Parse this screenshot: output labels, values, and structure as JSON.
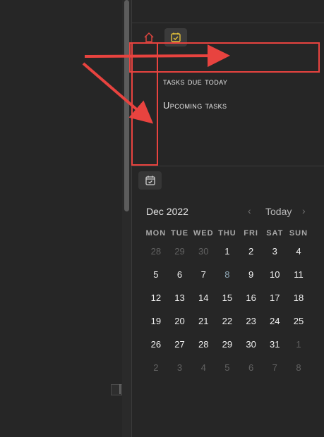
{
  "tabs": {
    "home_icon": "home-icon",
    "tasks_icon": "checkbox-calendar-icon"
  },
  "tasks": {
    "due_today": "tasks due today",
    "upcoming": "Upcoming tasks"
  },
  "calendar": {
    "tab_icon": "calendar-check-icon",
    "month_label": "Dec 2022",
    "prev": "‹",
    "today_label": "Today",
    "next": "›",
    "weekdays": [
      "MON",
      "TUE",
      "WED",
      "THU",
      "FRI",
      "SAT",
      "SUN"
    ],
    "weeks": [
      [
        {
          "d": "28",
          "o": true
        },
        {
          "d": "29",
          "o": true
        },
        {
          "d": "30",
          "o": true
        },
        {
          "d": "1"
        },
        {
          "d": "2"
        },
        {
          "d": "3"
        },
        {
          "d": "4"
        }
      ],
      [
        {
          "d": "5"
        },
        {
          "d": "6"
        },
        {
          "d": "7"
        },
        {
          "d": "8",
          "t": true
        },
        {
          "d": "9"
        },
        {
          "d": "10"
        },
        {
          "d": "11"
        }
      ],
      [
        {
          "d": "12"
        },
        {
          "d": "13"
        },
        {
          "d": "14"
        },
        {
          "d": "15"
        },
        {
          "d": "16"
        },
        {
          "d": "17"
        },
        {
          "d": "18"
        }
      ],
      [
        {
          "d": "19"
        },
        {
          "d": "20"
        },
        {
          "d": "21"
        },
        {
          "d": "22"
        },
        {
          "d": "23"
        },
        {
          "d": "24"
        },
        {
          "d": "25"
        }
      ],
      [
        {
          "d": "26"
        },
        {
          "d": "27"
        },
        {
          "d": "28"
        },
        {
          "d": "29"
        },
        {
          "d": "30"
        },
        {
          "d": "31"
        },
        {
          "d": "1",
          "o": true
        }
      ],
      [
        {
          "d": "2",
          "o": true
        },
        {
          "d": "3",
          "o": true
        },
        {
          "d": "4",
          "o": true
        },
        {
          "d": "5",
          "o": true
        },
        {
          "d": "6",
          "o": true
        },
        {
          "d": "7",
          "o": true
        },
        {
          "d": "8",
          "o": true
        }
      ]
    ]
  },
  "colors": {
    "annotation_red": "#e8433f",
    "home_icon": "#d9453f",
    "tasks_icon": "#e5c23a",
    "today_highlight": "#8fa7b5"
  }
}
